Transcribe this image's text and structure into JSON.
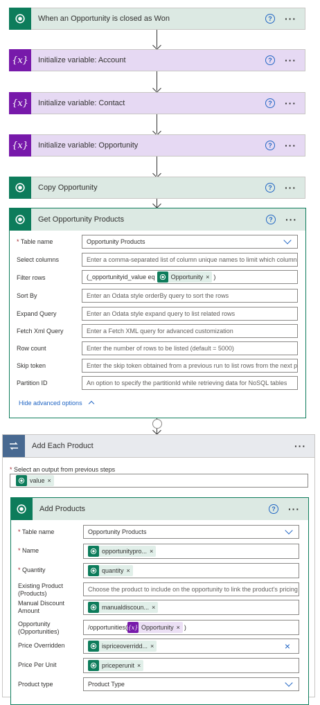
{
  "steps": [
    {
      "title": "When an Opportunity is closed as Won",
      "kind": "dataverse",
      "icon": "dataverse-icon"
    },
    {
      "title": "Initialize variable: Account",
      "kind": "variable",
      "icon": "variable-icon"
    },
    {
      "title": "Initialize variable: Contact",
      "kind": "variable",
      "icon": "variable-icon"
    },
    {
      "title": "Initialize variable: Opportunity",
      "kind": "variable",
      "icon": "variable-icon"
    },
    {
      "title": "Copy Opportunity",
      "kind": "dataverse",
      "icon": "dataverse-icon"
    }
  ],
  "help_glyph": "?",
  "more_glyph": "···",
  "variable_glyph": "{x}",
  "token_remove": "×",
  "get_products": {
    "title": "Get Opportunity Products",
    "fields": {
      "table_name_label": "Table name",
      "table_name_value": "Opportunity Products",
      "select_columns_label": "Select columns",
      "select_columns_placeholder": "Enter a comma-separated list of column unique names to limit which columns",
      "filter_rows_label": "Filter rows",
      "filter_rows_prefix": "(_opportunityid_value eq",
      "filter_rows_token": "Opportunity",
      "filter_rows_suffix": ")",
      "sort_by_label": "Sort By",
      "sort_by_placeholder": "Enter an Odata style orderBy query to sort the rows",
      "expand_query_label": "Expand Query",
      "expand_query_placeholder": "Enter an Odata style expand query to list related rows",
      "fetch_xml_label": "Fetch Xml Query",
      "fetch_xml_placeholder": "Enter a Fetch XML query for advanced customization",
      "row_count_label": "Row count",
      "row_count_placeholder": "Enter the number of rows to be listed (default = 5000)",
      "skip_token_label": "Skip token",
      "skip_token_placeholder": "Enter the skip token obtained from a previous run to list rows from the next pa",
      "partition_id_label": "Partition ID",
      "partition_id_placeholder": "An option to specify the partitionId while retrieving data for NoSQL tables"
    },
    "hide_advanced": "Hide advanced options",
    "hide_advanced_icon": "chevron-up-icon"
  },
  "loop": {
    "title": "Add Each Product",
    "select_label": "Select an output from previous steps",
    "select_token": "value"
  },
  "add_products": {
    "title": "Add Products",
    "table_name_label": "Table name",
    "table_name_value": "Opportunity Products",
    "name_label": "Name",
    "name_token": "opportunitypro...",
    "quantity_label": "Quantity",
    "quantity_token": "quantity",
    "existing_product_label_1": "Existing Product",
    "existing_product_label_2": "(Products)",
    "existing_product_placeholder": "Choose the product to include on the opportunity to link the product's pricing",
    "manual_discount_label_1": "Manual Discount",
    "manual_discount_label_2": "Amount",
    "manual_discount_token": "manualdiscoun...",
    "opportunity_label_1": "Opportunity",
    "opportunity_label_2": "(Opportunities)",
    "opportunity_prefix": "/opportunities(",
    "opportunity_token": "Opportunity",
    "opportunity_suffix": ")",
    "price_overridden_label": "Price Overridden",
    "price_overridden_token": "ispriceoverridd...",
    "price_overridden_clear": "×",
    "price_per_unit_label": "Price Per Unit",
    "price_per_unit_token": "priceperunit",
    "product_type_label": "Product type",
    "product_type_value": "Product Type"
  },
  "colors": {
    "dataverse_green": "#0d7c5b",
    "variable_purple": "#7719aa",
    "loop_blue": "#486991",
    "link_blue": "#2266c4",
    "required_red": "#a4262c"
  }
}
